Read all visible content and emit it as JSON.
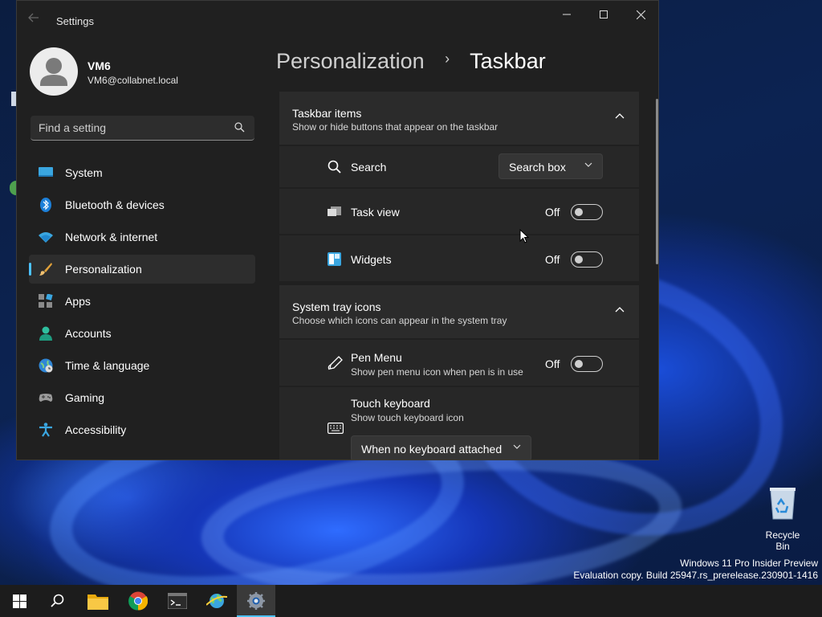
{
  "window": {
    "title": "Settings",
    "controls": {
      "minimize": "minimize",
      "maximize": "maximize",
      "close": "close"
    }
  },
  "profile": {
    "name": "VM6",
    "email": "VM6@collabnet.local"
  },
  "search": {
    "placeholder": "Find a setting"
  },
  "sidebar": {
    "items": [
      {
        "label": "System",
        "icon": "monitor-icon",
        "active": false
      },
      {
        "label": "Bluetooth & devices",
        "icon": "bluetooth-icon",
        "active": false
      },
      {
        "label": "Network & internet",
        "icon": "wifi-icon",
        "active": false
      },
      {
        "label": "Personalization",
        "icon": "brush-icon",
        "active": true
      },
      {
        "label": "Apps",
        "icon": "apps-icon",
        "active": false
      },
      {
        "label": "Accounts",
        "icon": "person-icon",
        "active": false
      },
      {
        "label": "Time & language",
        "icon": "globe-clock-icon",
        "active": false
      },
      {
        "label": "Gaming",
        "icon": "gamepad-icon",
        "active": false
      },
      {
        "label": "Accessibility",
        "icon": "accessibility-icon",
        "active": false
      }
    ]
  },
  "breadcrumb": {
    "parent": "Personalization",
    "separator": "›",
    "current": "Taskbar"
  },
  "taskbar_items": {
    "title": "Taskbar items",
    "subtitle": "Show or hide buttons that appear on the taskbar",
    "search": {
      "label": "Search",
      "value": "Search box"
    },
    "task_view": {
      "label": "Task view",
      "state": "Off"
    },
    "widgets": {
      "label": "Widgets",
      "state": "Off"
    }
  },
  "system_tray": {
    "title": "System tray icons",
    "subtitle": "Choose which icons can appear in the system tray",
    "pen_menu": {
      "label": "Pen Menu",
      "sub": "Show pen menu icon when pen is in use",
      "state": "Off"
    },
    "touch_keyboard": {
      "label": "Touch keyboard",
      "sub": "Show touch keyboard icon",
      "value": "When no keyboard attached"
    }
  },
  "desktop": {
    "recycle_bin": "Recycle Bin",
    "watermark_line1": "Windows 11 Pro Insider Preview",
    "watermark_line2": "Evaluation copy. Build 25947.rs_prerelease.230901-1416"
  },
  "taskbar": {
    "apps": [
      "start-icon",
      "search-icon",
      "file-explorer-icon",
      "chrome-icon",
      "terminal-icon",
      "network-globe-icon",
      "settings-icon"
    ]
  },
  "colors": {
    "accent": "#4cc2ff",
    "window_bg": "#202020",
    "card_bg": "#2b2b2b"
  }
}
